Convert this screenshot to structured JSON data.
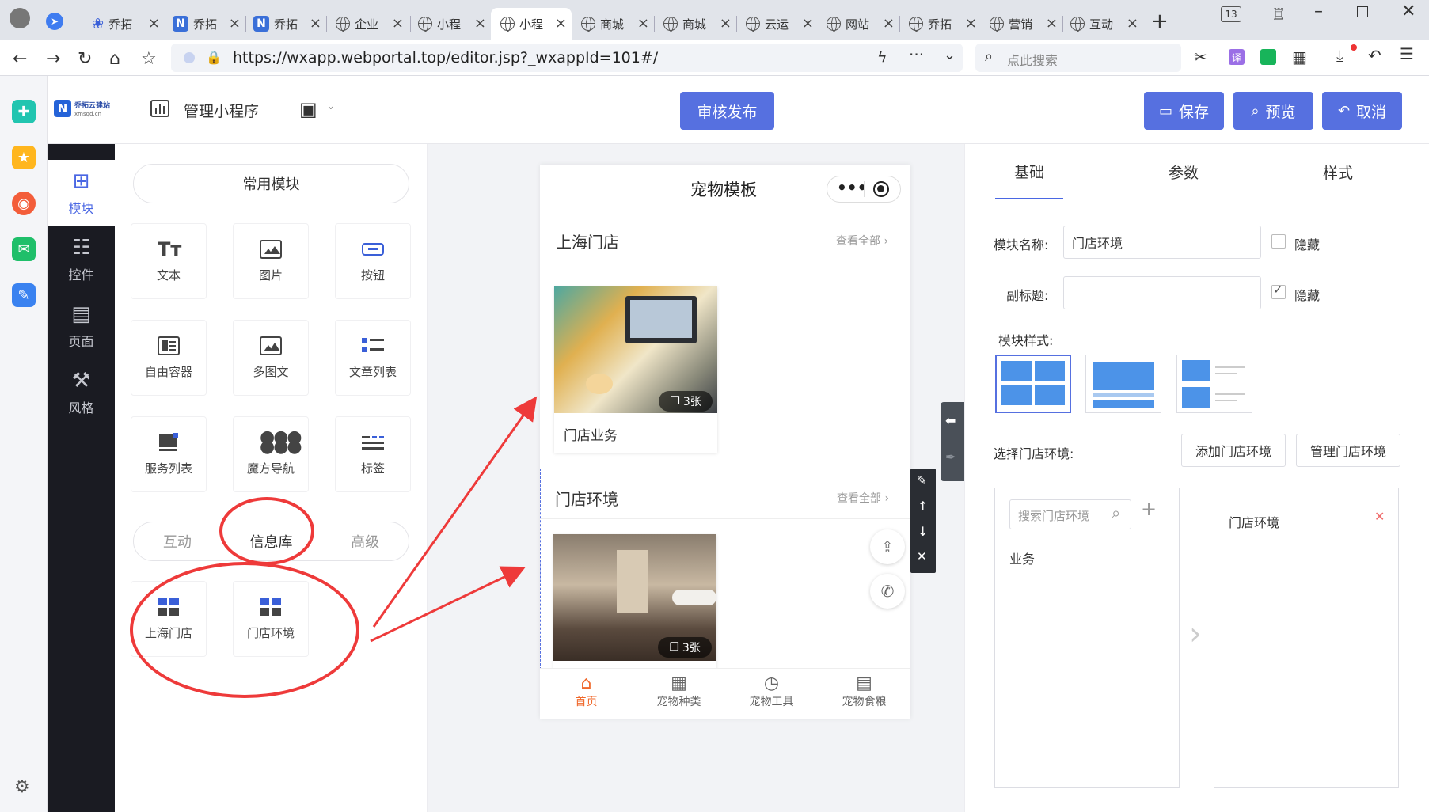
{
  "browser": {
    "tabs": [
      {
        "label": "乔拓",
        "icon": "paw-icon"
      },
      {
        "label": "乔拓",
        "icon": "n-logo-icon"
      },
      {
        "label": "乔拓",
        "icon": "n-logo-icon"
      },
      {
        "label": "企业",
        "icon": "globe-icon"
      },
      {
        "label": "小程",
        "icon": "globe-icon"
      },
      {
        "label": "小程",
        "icon": "globe-icon",
        "active": true
      },
      {
        "label": "商城",
        "icon": "globe-icon"
      },
      {
        "label": "商城",
        "icon": "globe-icon"
      },
      {
        "label": "云运",
        "icon": "globe-icon"
      },
      {
        "label": "网站",
        "icon": "globe-icon"
      },
      {
        "label": "乔拓",
        "icon": "globe-icon"
      },
      {
        "label": "营销",
        "icon": "globe-icon"
      },
      {
        "label": "互动",
        "icon": "globe-icon"
      }
    ],
    "tab_count": "13",
    "url": "https://wxapp.webportal.top/editor.jsp?_wxappId=101#/",
    "search_placeholder": "点此搜索"
  },
  "header": {
    "logo_text": "乔拓云建站",
    "logo_sub": "xmsqd.cn",
    "manage_label": "管理小程序",
    "publish_label": "审核发布",
    "save_label": "保存",
    "preview_label": "预览",
    "cancel_label": "取消"
  },
  "nav": {
    "items": [
      {
        "label": "模块",
        "icon": "plus-square-icon",
        "active": true
      },
      {
        "label": "控件",
        "icon": "sliders-icon"
      },
      {
        "label": "页面",
        "icon": "pages-icon"
      },
      {
        "label": "风格",
        "icon": "magic-wand-icon"
      }
    ]
  },
  "modules": {
    "common_label": "常用模块",
    "items": [
      {
        "label": "文本",
        "icon": "text-icon"
      },
      {
        "label": "图片",
        "icon": "image-icon"
      },
      {
        "label": "按钮",
        "icon": "button-icon"
      },
      {
        "label": "自由容器",
        "icon": "container-icon"
      },
      {
        "label": "多图文",
        "icon": "multi-image-icon"
      },
      {
        "label": "文章列表",
        "icon": "article-list-icon"
      },
      {
        "label": "服务列表",
        "icon": "service-list-icon"
      },
      {
        "label": "魔方导航",
        "icon": "grid-nav-icon"
      },
      {
        "label": "标签",
        "icon": "tag-icon"
      }
    ],
    "tabs": [
      {
        "label": "互动"
      },
      {
        "label": "信息库",
        "active": true
      },
      {
        "label": "高级"
      }
    ],
    "info_items": [
      {
        "label": "上海门店",
        "icon": "store-grid-icon"
      },
      {
        "label": "门店环境",
        "icon": "store-grid-icon"
      }
    ]
  },
  "phone": {
    "title": "宠物模板",
    "section1": {
      "title": "上海门店",
      "more": "查看全部",
      "card_caption": "门店业务",
      "photo_count": "3张"
    },
    "section2": {
      "title": "门店环境",
      "more": "查看全部",
      "photo_count": "3张"
    },
    "tabbar": [
      {
        "label": "首页",
        "icon": "home-icon",
        "active": true
      },
      {
        "label": "宠物种类",
        "icon": "categories-icon"
      },
      {
        "label": "宠物工具",
        "icon": "clock-icon"
      },
      {
        "label": "宠物食粮",
        "icon": "document-icon"
      }
    ]
  },
  "props": {
    "tabs": [
      {
        "label": "基础",
        "active": true
      },
      {
        "label": "参数"
      },
      {
        "label": "样式"
      }
    ],
    "name_label": "模块名称:",
    "name_value": "门店环境",
    "hide_label": "隐藏",
    "subtitle_label": "副标题:",
    "subtitle_value": "",
    "hide_label2": "隐藏",
    "style_label": "模块样式:",
    "select_label": "选择门店环境:",
    "add_btn": "添加门店环境",
    "manage_btn": "管理门店环境",
    "search_placeholder": "搜索门店环境",
    "left_list": [
      "业务"
    ],
    "right_list": [
      "门店环境"
    ]
  },
  "colors": {
    "accent": "#5670e0",
    "active_orange": "#f0692c",
    "annotation_red": "#ee3a3a"
  }
}
